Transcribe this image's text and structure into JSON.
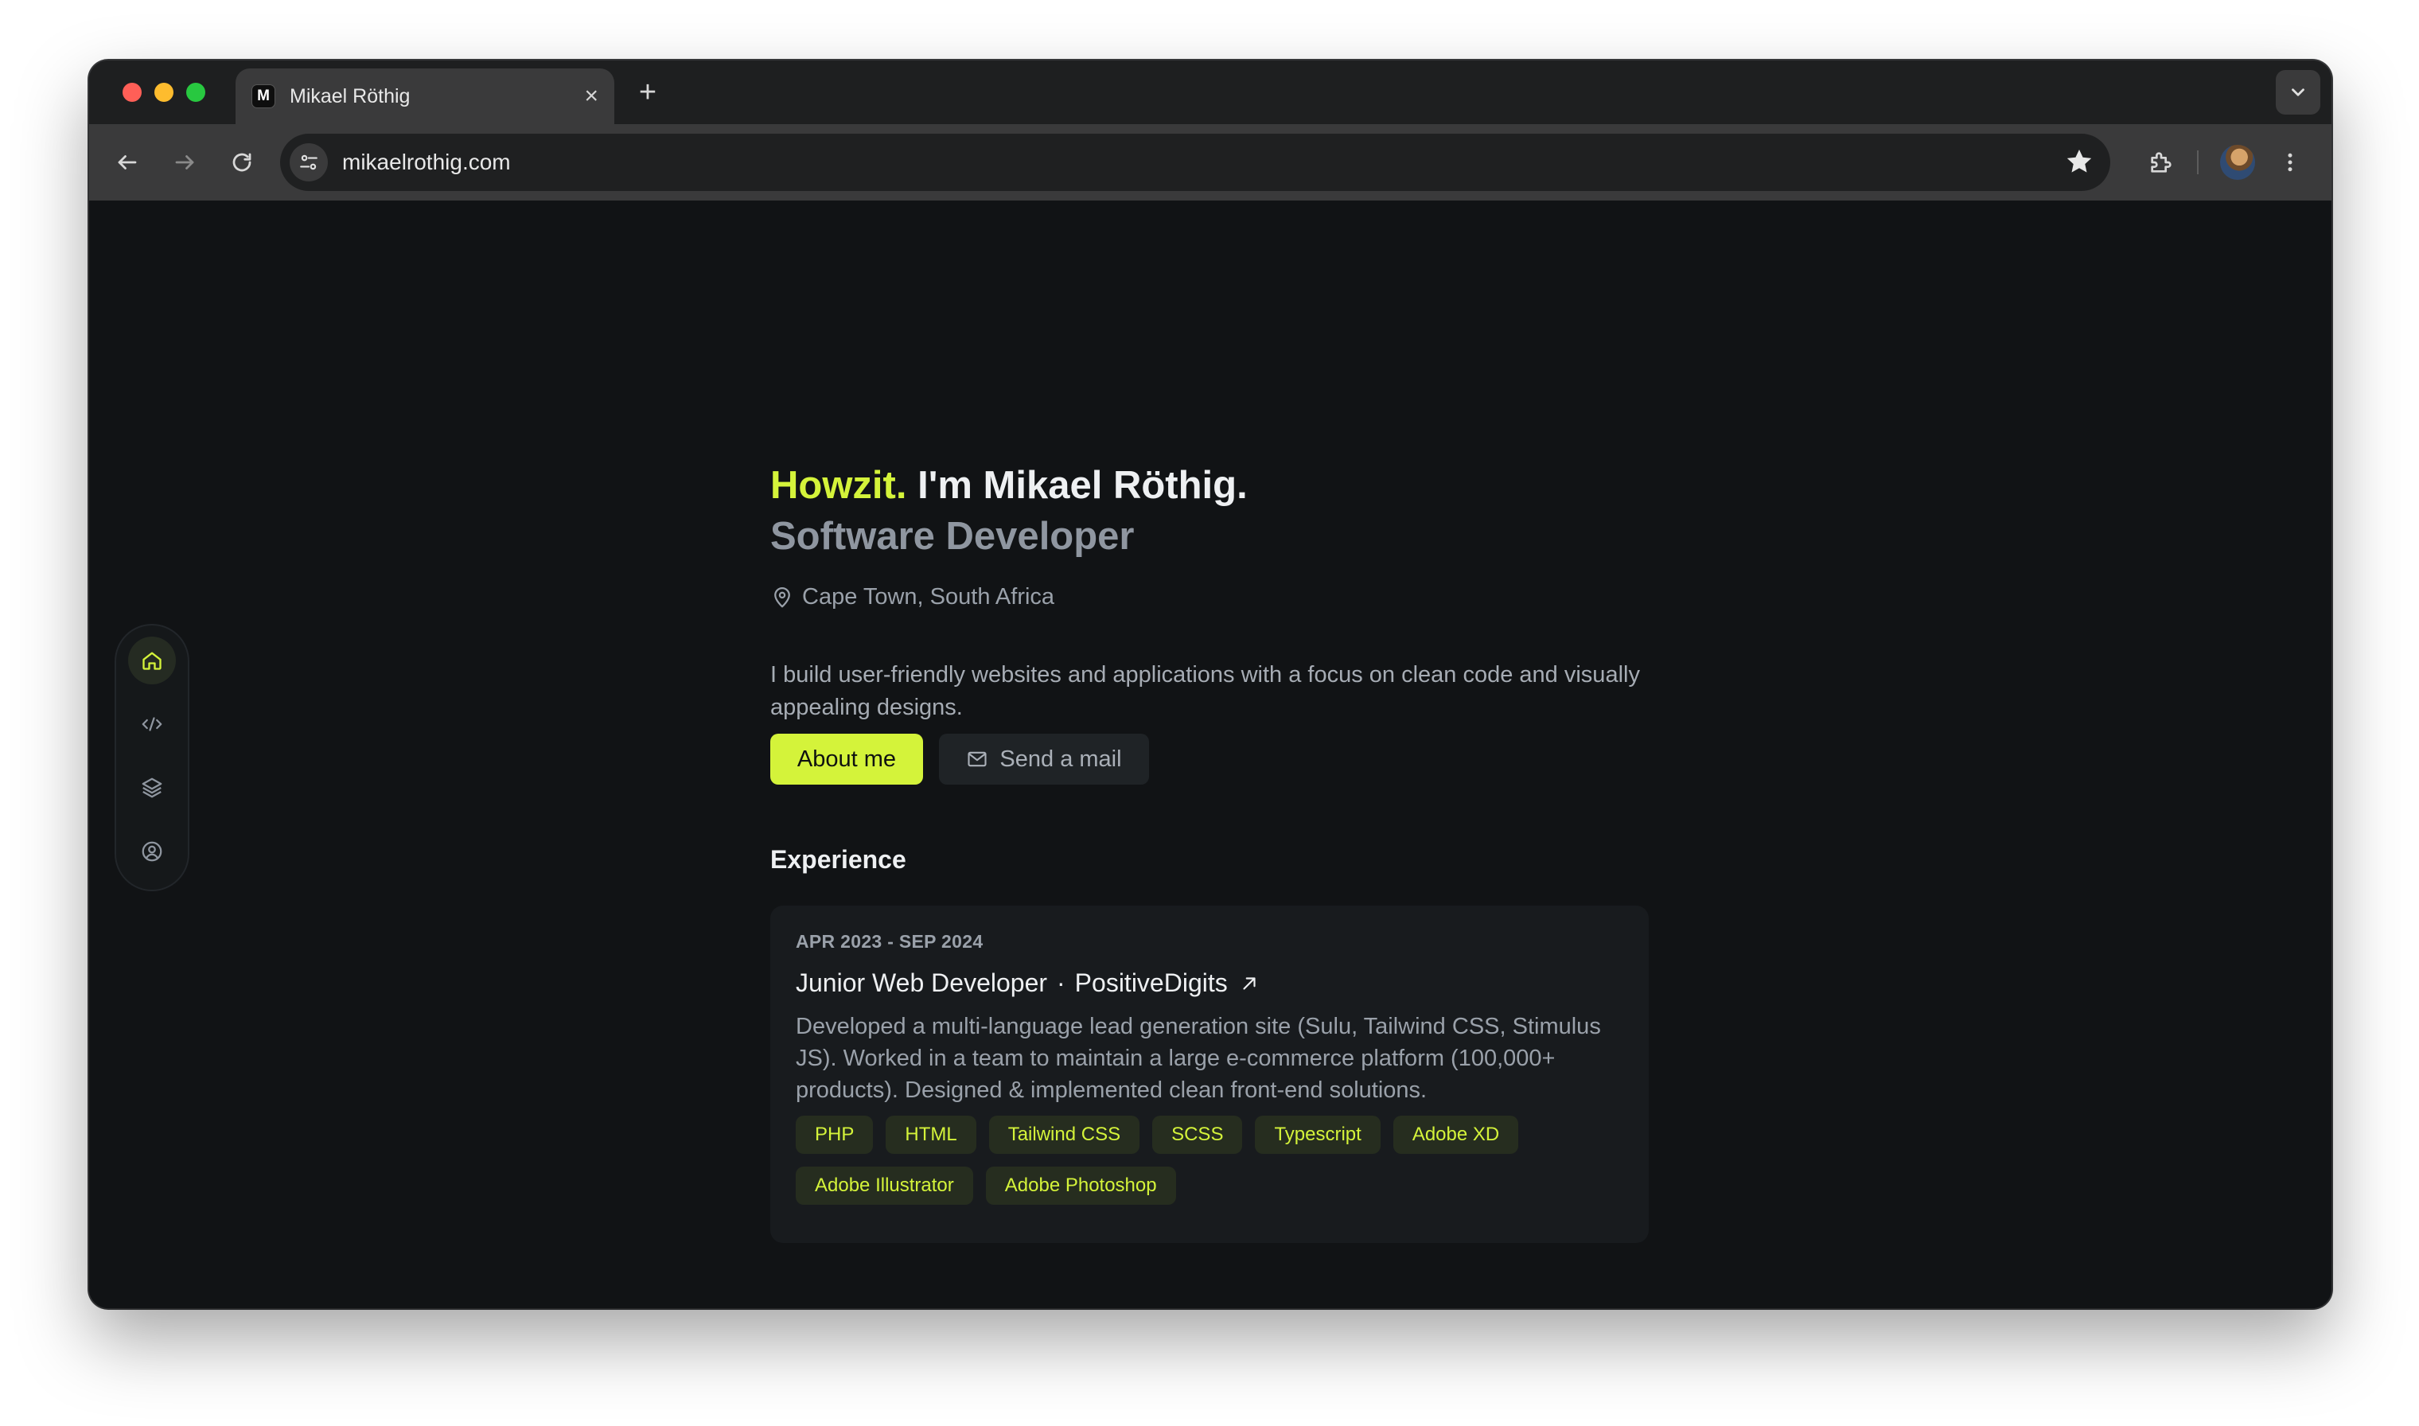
{
  "browser": {
    "tab_title": "Mikael Röthig",
    "favicon_letter": "M",
    "url": "mikaelrothig.com",
    "new_tab": "+",
    "close": "×"
  },
  "sidenav": {
    "items": [
      {
        "icon": "home-icon",
        "active": true
      },
      {
        "icon": "code-icon",
        "active": false
      },
      {
        "icon": "layers-icon",
        "active": false
      },
      {
        "icon": "user-circle-icon",
        "active": false
      }
    ]
  },
  "hero": {
    "greeting": "Howzit.",
    "intro": " I'm Mikael Röthig.",
    "role": "Software Developer",
    "location": "Cape Town, South Africa",
    "bio": "I build user-friendly websites and applications with a focus on clean code and visually appealing designs.",
    "primary_button": "About me",
    "secondary_button": "Send a mail"
  },
  "experience": {
    "title": "Experience",
    "items": [
      {
        "dates": "APR 2023 - SEP 2024",
        "position": "Junior Web Developer",
        "separator": "·",
        "company": "PositiveDigits",
        "description": "Developed a multi-language lead generation site (Sulu, Tailwind CSS, Stimulus JS). Worked in a team to maintain a large e-commerce platform (100,000+ products). Designed & implemented clean front-end solutions.",
        "tags": [
          "PHP",
          "HTML",
          "Tailwind CSS",
          "SCSS",
          "Typescript",
          "Adobe XD",
          "Adobe Illustrator",
          "Adobe Photoshop"
        ]
      }
    ]
  },
  "colors": {
    "accent": "#d4f33a",
    "background": "#111315",
    "card": "#181b1e"
  }
}
